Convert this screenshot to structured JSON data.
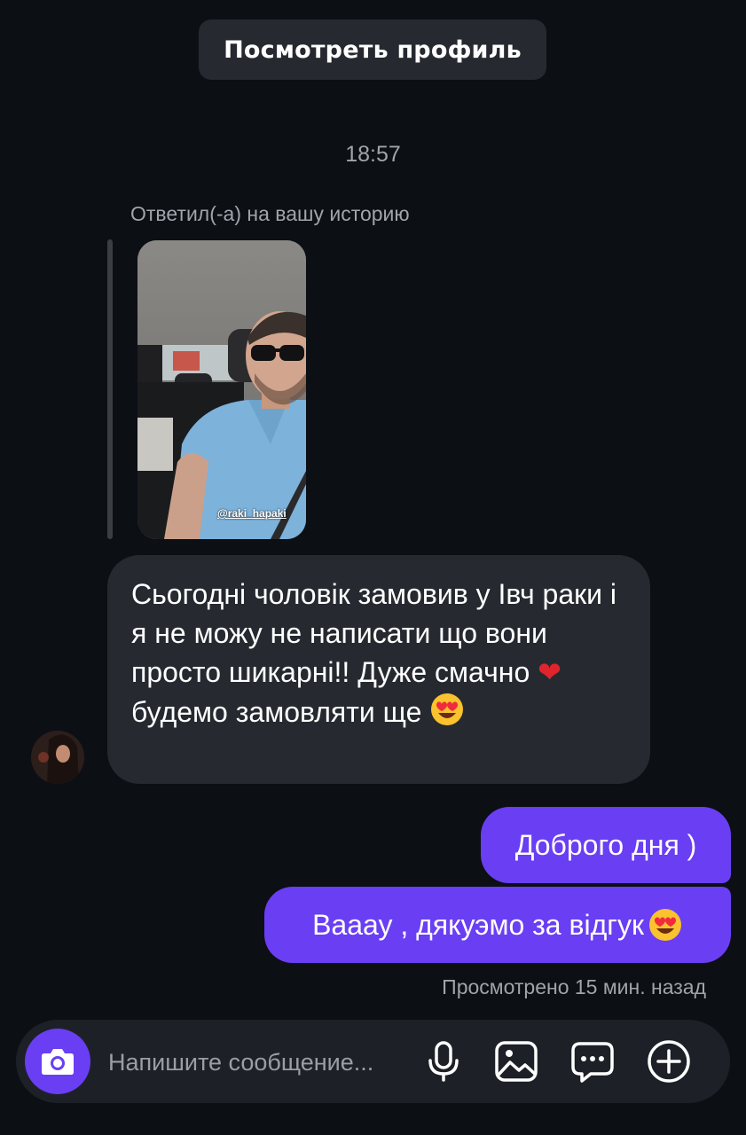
{
  "header": {
    "view_profile_label": "Посмотреть профиль"
  },
  "thread": {
    "timestamp": "18:57",
    "story_reply_label": "Ответил(-а) на вашу историю",
    "story_tag": "@raki_hapaki",
    "incoming_message": {
      "text_part1": "Сьогодні чоловік замовив у Івч раки і я не можу не написати що вони просто шикарні!! Дуже смачно ",
      "heart_emoji": "❤",
      "text_part2": " будемо замовляти ще "
    },
    "outgoing_messages": [
      {
        "text": "Доброго дня )"
      },
      {
        "text": "Вааау , дякуэмо за відгук "
      }
    ],
    "seen_status": "Просмотрено 15 мин. назад"
  },
  "composer": {
    "placeholder": "Напишите сообщение..."
  },
  "colors": {
    "background": "#0c0f14",
    "bubble_incoming": "#262a30",
    "bubble_outgoing": "#6a3ef3",
    "muted_text": "#a0a4ab",
    "accent": "#6a3ef3"
  },
  "icons": [
    "camera-icon",
    "microphone-icon",
    "gallery-icon",
    "sticker-icon",
    "plus-icon",
    "heart-eyes-emoji-icon",
    "heart-emoji-icon"
  ]
}
